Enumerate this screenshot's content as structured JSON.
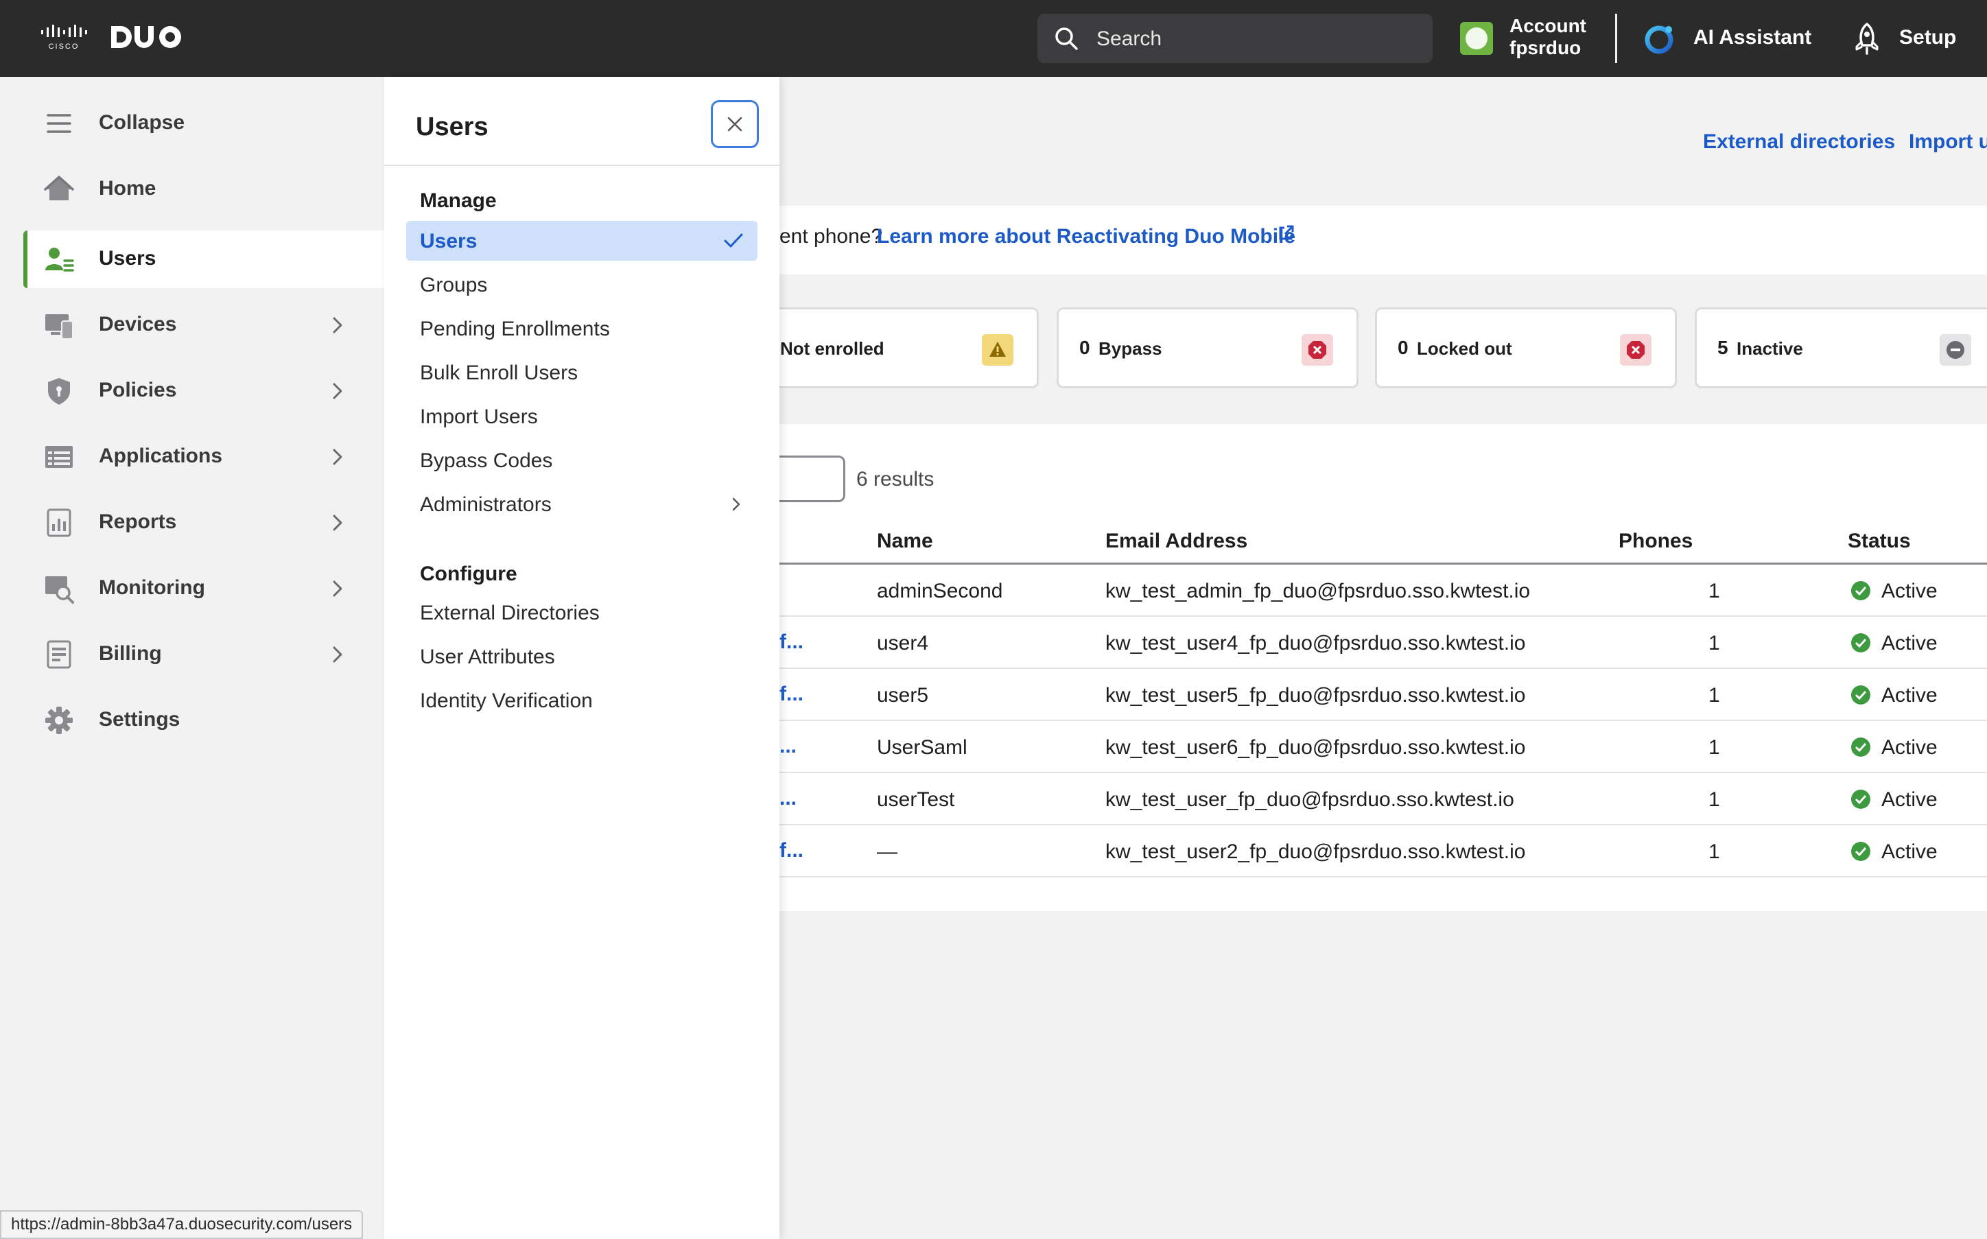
{
  "topbar": {
    "search_placeholder": "Search",
    "account_label": "Account",
    "account_name": "fpsrduo",
    "ai_assistant_label": "AI Assistant",
    "setup_label": "Setup"
  },
  "leftnav": {
    "items": [
      {
        "label": "Collapse",
        "icon": "hamburger-icon"
      },
      {
        "label": "Home",
        "icon": "home-icon"
      },
      {
        "label": "Users",
        "icon": "users-icon",
        "active": true
      },
      {
        "label": "Devices",
        "icon": "devices-icon",
        "has_submenu": true
      },
      {
        "label": "Policies",
        "icon": "shield-icon",
        "has_submenu": true
      },
      {
        "label": "Applications",
        "icon": "applications-icon",
        "has_submenu": true
      },
      {
        "label": "Reports",
        "icon": "reports-icon",
        "has_submenu": true
      },
      {
        "label": "Monitoring",
        "icon": "monitoring-icon",
        "has_submenu": true
      },
      {
        "label": "Billing",
        "icon": "billing-icon",
        "has_submenu": true
      },
      {
        "label": "Settings",
        "icon": "gear-icon"
      }
    ]
  },
  "flyout": {
    "title": "Users",
    "manage_heading": "Manage",
    "manage_items": [
      {
        "label": "Users",
        "selected": true
      },
      {
        "label": "Groups"
      },
      {
        "label": "Pending Enrollments"
      },
      {
        "label": "Bulk Enroll Users"
      },
      {
        "label": "Import Users"
      },
      {
        "label": "Bypass Codes"
      },
      {
        "label": "Administrators",
        "has_submenu": true
      }
    ],
    "configure_heading": "Configure",
    "configure_items": [
      {
        "label": "External Directories"
      },
      {
        "label": "User Attributes"
      },
      {
        "label": "Identity Verification"
      }
    ]
  },
  "main": {
    "external_directories_link": "External directories",
    "import_link": "Import u",
    "banner_text": "ent phone?",
    "banner_link": "Learn more about Reactivating Duo Mobile",
    "stats": [
      {
        "count": "",
        "label": "Not enrolled",
        "icon": "warning-icon",
        "color": "#f3d77b"
      },
      {
        "count": "0",
        "label": "Bypass",
        "icon": "error-icon",
        "color": "#f7d4d6"
      },
      {
        "count": "0",
        "label": "Locked out",
        "icon": "error-icon",
        "color": "#f7d4d6"
      },
      {
        "count": "5",
        "label": "Inactive",
        "icon": "minus-icon",
        "color": "#e4e4e6"
      }
    ],
    "results_text": "6 results",
    "table": {
      "headers": [
        "Name",
        "Email Address",
        "Phones",
        "Status"
      ],
      "rows": [
        {
          "prefix": "",
          "name": "adminSecond",
          "email": "kw_test_admin_fp_duo@fpsrduo.sso.kwtest.io",
          "phones": "1",
          "status": "Active"
        },
        {
          "prefix": "f...",
          "name": "user4",
          "email": "kw_test_user4_fp_duo@fpsrduo.sso.kwtest.io",
          "phones": "1",
          "status": "Active"
        },
        {
          "prefix": "f...",
          "name": "user5",
          "email": "kw_test_user5_fp_duo@fpsrduo.sso.kwtest.io",
          "phones": "1",
          "status": "Active"
        },
        {
          "prefix": "...",
          "name": "UserSaml",
          "email": "kw_test_user6_fp_duo@fpsrduo.sso.kwtest.io",
          "phones": "1",
          "status": "Active"
        },
        {
          "prefix": "...",
          "name": "userTest",
          "email": "kw_test_user_fp_duo@fpsrduo.sso.kwtest.io",
          "phones": "1",
          "status": "Active"
        },
        {
          "prefix": "f...",
          "name": "—",
          "email": "kw_test_user2_fp_duo@fpsrduo.sso.kwtest.io",
          "phones": "1",
          "status": "Active"
        }
      ]
    }
  },
  "statusbar": {
    "url": "https://admin-8bb3a47a.duosecurity.com/users"
  },
  "colors": {
    "topbar_bg": "#2b2b2c",
    "accent_blue": "#1c5bc7",
    "active_green": "#4f9a3a",
    "status_green": "#3d9a3e"
  }
}
